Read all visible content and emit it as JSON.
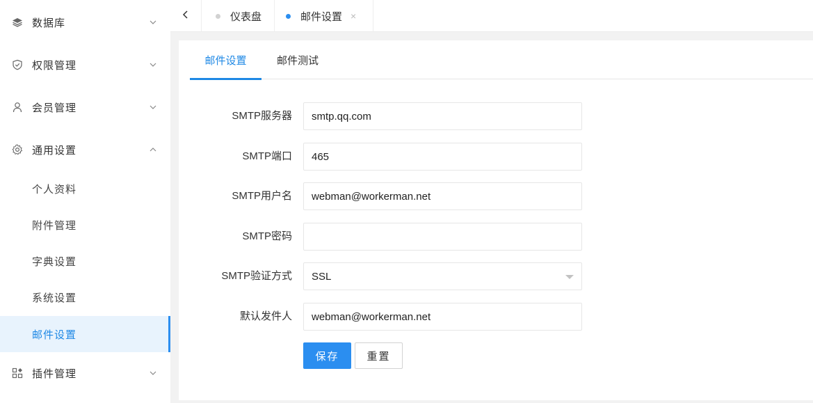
{
  "sidebar": {
    "items": [
      {
        "label": "数据库",
        "icon": "layers-icon",
        "expanded": false
      },
      {
        "label": "权限管理",
        "icon": "shield-icon",
        "expanded": false
      },
      {
        "label": "会员管理",
        "icon": "user-icon",
        "expanded": false
      },
      {
        "label": "通用设置",
        "icon": "gear-icon",
        "expanded": true
      },
      {
        "label": "插件管理",
        "icon": "plugin-icon",
        "expanded": false
      }
    ],
    "submenu": [
      {
        "label": "个人资料"
      },
      {
        "label": "附件管理"
      },
      {
        "label": "字典设置"
      },
      {
        "label": "系统设置"
      },
      {
        "label": "邮件设置",
        "active": true
      }
    ]
  },
  "tabs": [
    {
      "label": "仪表盘",
      "active": false
    },
    {
      "label": "邮件设置",
      "active": true,
      "close": "×"
    }
  ],
  "inner_tabs": [
    {
      "label": "邮件设置",
      "active": true
    },
    {
      "label": "邮件测试",
      "active": false
    }
  ],
  "form": {
    "smtp_host": {
      "label": "SMTP服务器",
      "value": "smtp.qq.com"
    },
    "smtp_port": {
      "label": "SMTP端口",
      "value": "465"
    },
    "smtp_user": {
      "label": "SMTP用户名",
      "value": "webman@workerman.net"
    },
    "smtp_password": {
      "label": "SMTP密码",
      "value": ""
    },
    "smtp_secure": {
      "label": "SMTP验证方式",
      "value": "SSL"
    },
    "sender": {
      "label": "默认发件人",
      "value": "webman@workerman.net"
    },
    "save_label": "保存",
    "reset_label": "重置"
  },
  "colors": {
    "accent": "#1e88e5",
    "primary_button": "#2b8ef0",
    "active_menu_bg": "#e8f3fd",
    "page_bg": "#f2f2f2"
  }
}
